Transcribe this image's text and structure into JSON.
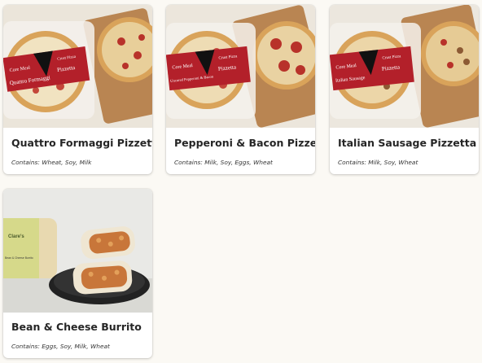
{
  "products": [
    {
      "name": "Quattro Formaggi Pizzetta",
      "allergens": "Contains: Wheat, Soy, Milk",
      "package_label": "Quattro Formaggi",
      "package_brand": "Pizzetta",
      "package_tag": "Crust Pizza",
      "package_tag2": "Core Meal"
    },
    {
      "name": "Pepperoni & Bacon Pizzetta",
      "allergens": "Contains: Milk, Soy, Eggs, Wheat",
      "package_label": "Uncured Pepperoni & Bacon",
      "package_brand": "Pizzetta",
      "package_tag": "Crust Pizza",
      "package_tag2": "Core Meal"
    },
    {
      "name": "Italian Sausage Pizzetta",
      "allergens": "Contains: Milk, Soy, Wheat",
      "package_label": "Italian Sausage",
      "package_brand": "Pizzetta",
      "package_tag": "Crust Pizza",
      "package_tag2": "Core Meal"
    },
    {
      "name": "Bean & Cheese Burrito",
      "allergens": "Contains: Eggs, Soy, Milk, Wheat",
      "package_label": "Bean & Cheese Burrito",
      "package_brand": "Clare's"
    }
  ],
  "colors": {
    "package_red": "#b3202a",
    "crust": "#d9a35a",
    "board": "#b98552",
    "tomato": "#b8322a",
    "background": "#fbf9f4"
  }
}
